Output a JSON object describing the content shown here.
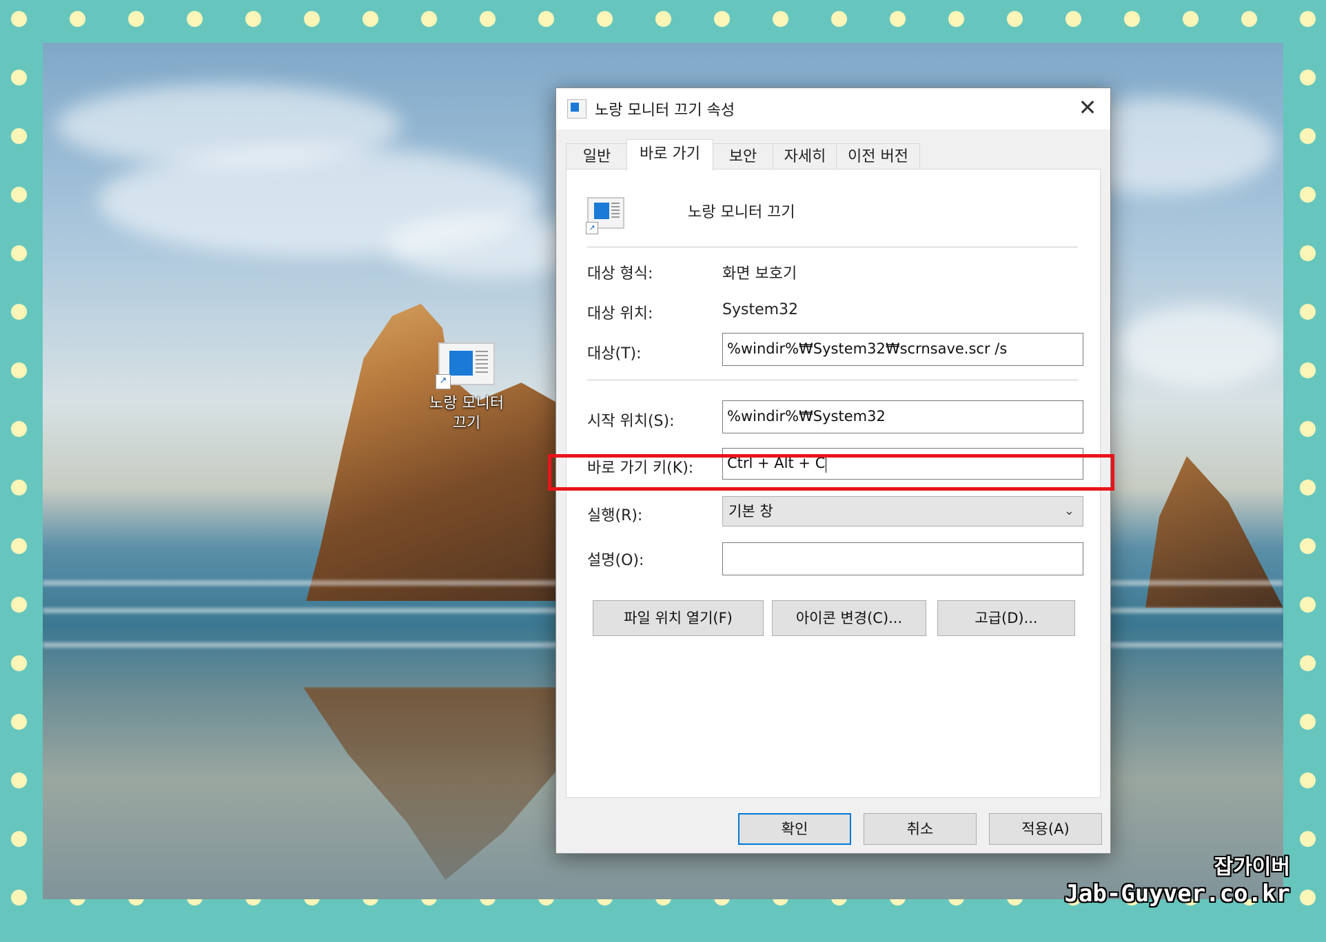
{
  "desktop": {
    "icon_label_line1": "노랑 모니터",
    "icon_label_line2": "끄기"
  },
  "dialog": {
    "title": "노랑 모니터 끄기 속성",
    "close_glyph": "✕",
    "tabs": [
      {
        "label": "일반",
        "active": false
      },
      {
        "label": "바로 가기",
        "active": true
      },
      {
        "label": "보안",
        "active": false
      },
      {
        "label": "자세히",
        "active": false
      },
      {
        "label": "이전 버전",
        "active": false
      }
    ],
    "shortcut_name": "노랑 모니터 끄기",
    "target_type": {
      "label": "대상 형식:",
      "value": "화면 보호기"
    },
    "target_location": {
      "label": "대상 위치:",
      "value": "System32"
    },
    "target": {
      "label": "대상(T):",
      "value": "%windir%₩System32₩scrnsave.scr /s"
    },
    "start_in": {
      "label": "시작 위치(S):",
      "value": "%windir%₩System32"
    },
    "shortcut_key": {
      "label": "바로 가기 키(K):",
      "value": "Ctrl + Alt + C"
    },
    "run": {
      "label": "실행(R):",
      "value": "기본 창"
    },
    "comment": {
      "label": "설명(O):",
      "value": ""
    },
    "buttons": {
      "open_file_location": "파일 위치 열기(F)",
      "change_icon": "아이콘 변경(C)...",
      "advanced": "고급(D)..."
    },
    "footer": {
      "ok": "확인",
      "cancel": "취소",
      "apply": "적용(A)"
    }
  },
  "watermark": {
    "line1": "잡가이버",
    "line2": "Jab-Guyver.co.kr"
  },
  "colors": {
    "frame_teal": "#66c6be",
    "dots": "#fbf5b8",
    "highlight_red": "#e8141b",
    "accent_blue": "#0078d7"
  },
  "icons": {
    "window_icon": "screensaver-shortcut-icon",
    "close": "close-icon",
    "dropdown": "chevron-down-icon"
  }
}
